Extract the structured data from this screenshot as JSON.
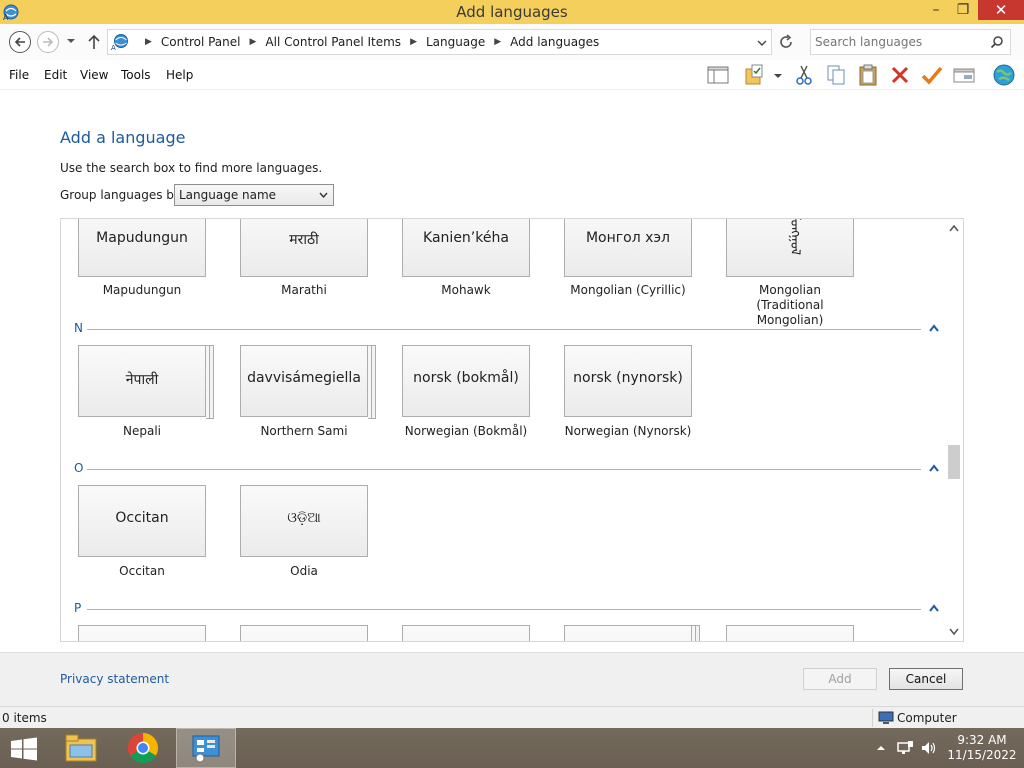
{
  "window": {
    "title": "Add languages",
    "controls": {
      "minimize": "–",
      "maximize": "❐",
      "close": "✕"
    }
  },
  "address": {
    "breadcrumbs": [
      "Control Panel",
      "All Control Panel Items",
      "Language",
      "Add languages"
    ],
    "search_placeholder": "Search languages"
  },
  "menu": {
    "items": [
      "File",
      "Edit",
      "View",
      "Tools",
      "Help"
    ],
    "toolbar_icons": [
      "layout-icon",
      "properties-folder-icon",
      "cut-icon",
      "copy-icon",
      "paste-icon",
      "delete-icon",
      "check-icon",
      "window-icon",
      "globe-icon"
    ]
  },
  "page": {
    "heading": "Add a language",
    "hint": "Use the search box to find more languages.",
    "group_label": "Group languages by:",
    "group_value": "Language name"
  },
  "languages": {
    "row_m": [
      {
        "native": "Mapudungun",
        "name": "Mapudungun"
      },
      {
        "native": "मराठी",
        "name": "Marathi"
      },
      {
        "native": "Kanien’kéha",
        "name": "Mohawk"
      },
      {
        "native": "Монгол хэл",
        "name": "Mongolian (Cyrillic)"
      },
      {
        "native": "ᠮᠣᠩᠭᠣᠯ",
        "name": "Mongolian (Traditional Mongolian)",
        "name_line1": "Mongolian (Traditional",
        "name_line2": "Mongolian)"
      }
    ],
    "section_n": {
      "letter": "N"
    },
    "row_n": [
      {
        "native": "नेपाली",
        "name": "Nepali",
        "stack": true
      },
      {
        "native": "davvisámegiella",
        "name": "Northern Sami",
        "stack": true
      },
      {
        "native": "norsk (bokmål)",
        "name": "Norwegian (Bokmål)"
      },
      {
        "native": "norsk (nynorsk)",
        "name": "Norwegian (Nynorsk)"
      }
    ],
    "section_o": {
      "letter": "O"
    },
    "row_o": [
      {
        "native": "Occitan",
        "name": "Occitan"
      },
      {
        "native": "ଓଡ଼ିଆ",
        "name": "Odia"
      }
    ],
    "section_p": {
      "letter": "P"
    }
  },
  "actions": {
    "privacy": "Privacy statement",
    "add": "Add",
    "cancel": "Cancel"
  },
  "status": {
    "items": "0 items",
    "location": "Computer"
  },
  "taskbar": {
    "apps": [
      "file-explorer-icon",
      "chrome-icon",
      "control-panel-icon"
    ],
    "time": "9:32 AM",
    "date": "11/15/2022"
  },
  "colors": {
    "titlebar": "#f4cf5c",
    "close_button": "#c7372f",
    "link_blue": "#1e5aa0",
    "taskbar": "#6f6457"
  }
}
